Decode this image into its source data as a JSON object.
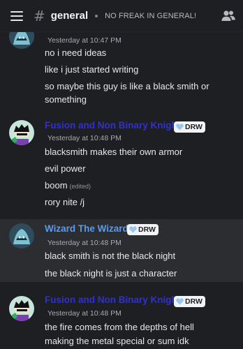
{
  "topbar": {
    "channel": "general",
    "topic": "NO FREAK IN GENERAL!",
    "menu_icon": "hamburger-menu-icon",
    "hash_icon": "#",
    "members_icon": "members-icon"
  },
  "colors": {
    "fusion_name": "#2f2fd8",
    "wizard_name": "#5a9bf0",
    "badge_bg": "#f2f3f5",
    "badge_heart": "#9ac6f0",
    "highlight_bg": "#2b2d31"
  },
  "groups": [
    {
      "timestamp": "Yesterday at 10:47 PM",
      "lines": [
        "no i need ideas",
        "like i just started writing",
        "so maybe this guy is like a black smith or",
        "something"
      ]
    },
    {
      "username": "Fusion and Non Binary Knight",
      "badge": "DRW",
      "timestamp": "Yesterday at 10:48 PM",
      "lines": [
        "blacksmith makes their own armor",
        "evil power",
        "boom",
        "rory nite /j"
      ],
      "edited": "(edited)"
    },
    {
      "username": "Wizard The Wizard",
      "badge": "DRW",
      "timestamp": "Yesterday at 10:48 PM",
      "lines": [
        "black smith is not the black night",
        "the black night is just a character"
      ]
    },
    {
      "username": "Fusion and Non Binary Knight",
      "badge": "DRW",
      "timestamp": "Yesterday at 10:48 PM",
      "lines": [
        "the fire comes from the depths of hell",
        "making the metal special or sum idk"
      ]
    }
  ]
}
